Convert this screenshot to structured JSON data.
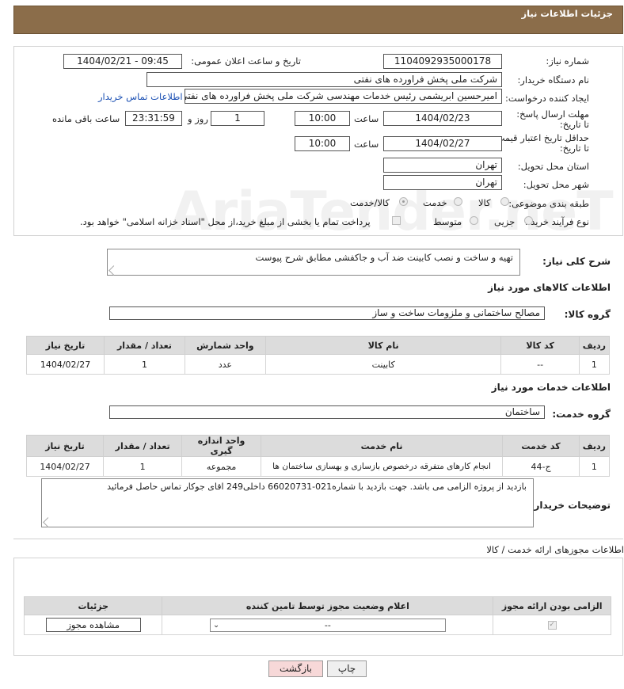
{
  "header": {
    "title": "جزئیات اطلاعات نیاز"
  },
  "form": {
    "need_number_label": "شماره نیاز:",
    "need_number": "1104092935000178",
    "announce_label": "تاریخ و ساعت اعلان عمومی:",
    "announce_value": "1404/02/21 - 09:45",
    "buyer_org_label": "نام دستگاه خریدار:",
    "buyer_org": "شرکت ملی پخش فراورده های نفتی",
    "requester_label": "ایجاد کننده درخواست:",
    "requester": "امیرحسین ابریشمی رئیس خدمات مهندسی شرکت ملی پخش فراورده های نفتی",
    "buyer_contact_link": "اطلاعات تماس خریدار",
    "reply_deadline_label": "مهلت ارسال پاسخ: تا تاریخ:",
    "reply_date": "1404/02/23",
    "time_label": "ساعت",
    "reply_time": "10:00",
    "days_value": "1",
    "days_label": "روز و",
    "remaining_time": "23:31:59",
    "remaining_label": "ساعت باقی مانده",
    "price_deadline_label": "حداقل تاریخ اعتبار قیمت: تا تاریخ:",
    "price_date": "1404/02/27",
    "price_time": "10:00",
    "province_label": "استان محل تحویل:",
    "province": "تهران",
    "city_label": "شهر محل تحویل:",
    "city": "تهران",
    "category_label": "طبقه بندی موضوعی:",
    "category_goods": "کالا",
    "category_service": "خدمت",
    "category_both": "کالا/خدمت",
    "purchase_type_label": "نوع فرآیند خرید :",
    "purchase_partial": "جزیی",
    "purchase_medium": "متوسط",
    "payment_note": "پرداخت تمام یا بخشی از مبلغ خرید،از محل \"اسناد خزانه اسلامی\" خواهد بود."
  },
  "description": {
    "label": "شرح کلی نیاز:",
    "text": "تهیه و ساخت و نصب کابینت ضد آب و جاکفشی مطابق شرح پیوست"
  },
  "goods": {
    "section_title": "اطلاعات کالاهای مورد نیاز",
    "group_label": "گروه کالا:",
    "group_value": "مصالح ساختمانی و ملزومات ساخت و ساز",
    "columns": [
      "ردیف",
      "کد کالا",
      "نام کالا",
      "واحد شمارش",
      "تعداد / مقدار",
      "تاریخ نیاز"
    ],
    "rows": [
      {
        "row": "1",
        "code": "--",
        "name": "کابینت",
        "unit": "عدد",
        "qty": "1",
        "date": "1404/02/27"
      }
    ]
  },
  "services": {
    "section_title": "اطلاعات خدمات مورد نیاز",
    "group_label": "گروه خدمت:",
    "group_value": "ساختمان",
    "columns": [
      "ردیف",
      "کد خدمت",
      "نام خدمت",
      "واحد اندازه گیری",
      "تعداد / مقدار",
      "تاریخ نیاز"
    ],
    "rows": [
      {
        "row": "1",
        "code": "ج-44",
        "name": "انجام کارهای متفرقه درخصوص بازسازی و بهسازی ساختمان ها",
        "unit": "مجموعه",
        "qty": "1",
        "date": "1404/02/27"
      }
    ]
  },
  "buyer_notes": {
    "label": "توضیحات خریدار:",
    "text": "بازدید از پروژه الزامی می باشد. جهت بازدید با شماره021-66020731 داخلی249 اقای جوکار تماس حاصل فرمائید"
  },
  "permits": {
    "section_title": "اطلاعات مجوزهای ارائه خدمت / کالا",
    "columns": [
      "الزامی بودن ارائه مجوز",
      "اعلام وضعیت مجوز توسط تامین کننده",
      "جزئیات"
    ],
    "select_value": "--",
    "view_button": "مشاهده مجوز"
  },
  "actions": {
    "print": "چاپ",
    "back": "بازگشت"
  },
  "watermark": "AriaTender.neT",
  "colors": {
    "header_bg": "#8b6d4a",
    "link": "#1a4fb3",
    "back_button": "#f7d8d8"
  }
}
